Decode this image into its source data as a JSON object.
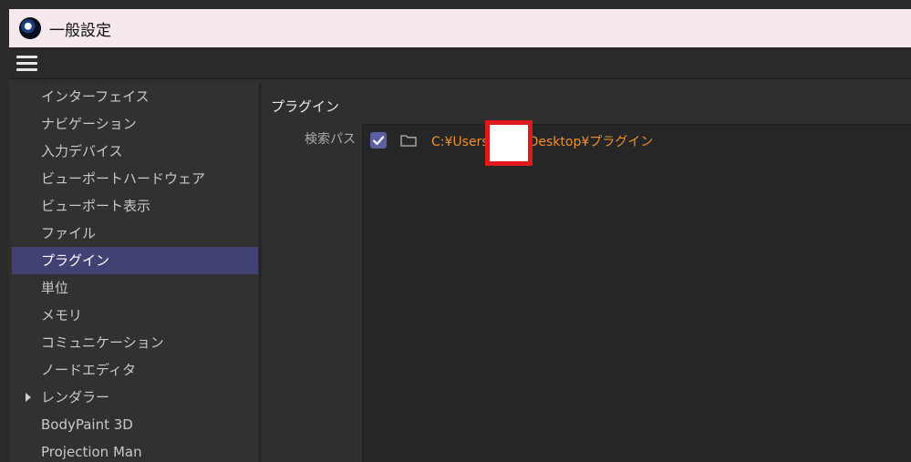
{
  "window": {
    "title": "一般設定"
  },
  "toolbar": {
    "menu_icon": "hamburger-menu-icon"
  },
  "sidebar": {
    "items": [
      {
        "label": "インターフェイス",
        "selected": false,
        "expandable": false
      },
      {
        "label": "ナビゲーション",
        "selected": false,
        "expandable": false
      },
      {
        "label": "入力デバイス",
        "selected": false,
        "expandable": false
      },
      {
        "label": "ビューポートハードウェア",
        "selected": false,
        "expandable": false
      },
      {
        "label": "ビューポート表示",
        "selected": false,
        "expandable": false
      },
      {
        "label": "ファイル",
        "selected": false,
        "expandable": false
      },
      {
        "label": "プラグイン",
        "selected": true,
        "expandable": false
      },
      {
        "label": "単位",
        "selected": false,
        "expandable": false
      },
      {
        "label": "メモリ",
        "selected": false,
        "expandable": false
      },
      {
        "label": "コミュニケーション",
        "selected": false,
        "expandable": false
      },
      {
        "label": "ノードエディタ",
        "selected": false,
        "expandable": false
      },
      {
        "label": "レンダラー",
        "selected": false,
        "expandable": true
      },
      {
        "label": "BodyPaint 3D",
        "selected": false,
        "expandable": false
      },
      {
        "label": "Projection Man",
        "selected": false,
        "expandable": false
      }
    ]
  },
  "content": {
    "section_title": "プラグイン",
    "search_path_label": "検索パス",
    "paths": [
      {
        "enabled": true,
        "prefix": "C:¥Users",
        "suffix": "Desktop¥プラグイン"
      }
    ]
  },
  "colors": {
    "selected_bg": "#414273",
    "path_text": "#f0902e",
    "checkbox": "#5b5ea0",
    "redaction_border": "#e01a1a"
  }
}
